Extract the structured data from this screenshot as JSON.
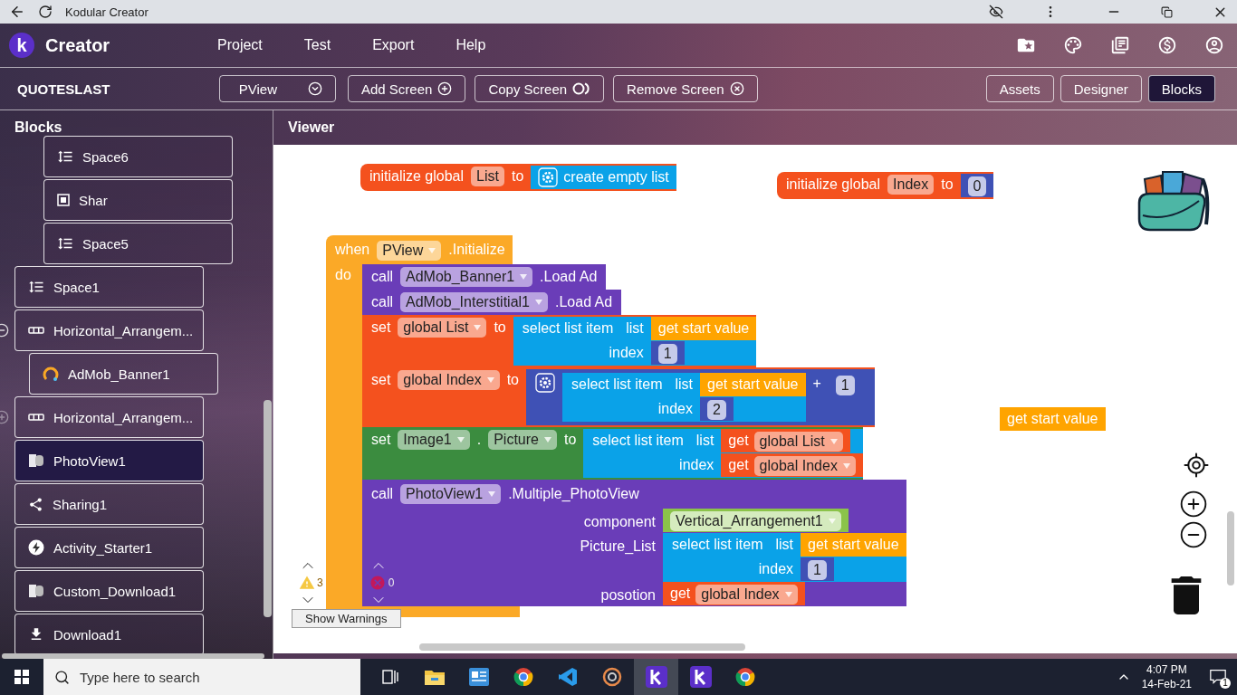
{
  "browser": {
    "title": "Kodular Creator"
  },
  "header": {
    "logo": "k",
    "brand": "Creator",
    "menu": [
      "Project",
      "Test",
      "Export",
      "Help"
    ]
  },
  "toolbar": {
    "project": "QUOTESLAST",
    "screen": "PView",
    "actions": [
      {
        "kind": "add",
        "label": "Add Screen"
      },
      {
        "kind": "copy",
        "label": "Copy Screen"
      },
      {
        "kind": "remove",
        "label": "Remove Screen"
      }
    ],
    "views": [
      {
        "label": "Assets",
        "selected": false
      },
      {
        "label": "Designer",
        "selected": false
      },
      {
        "label": "Blocks",
        "selected": true
      }
    ]
  },
  "sidebar": {
    "title": "Blocks",
    "items": [
      {
        "children": [
          {
            "children": [
              {
                "label": "Space6",
                "kind": "space",
                "selected": false
              },
              {
                "label": "Shar",
                "kind": "square",
                "selected": false
              },
              {
                "label": "Space5",
                "kind": "space",
                "selected": false
              }
            ]
          }
        ]
      },
      {
        "label": "Space1",
        "kind": "space",
        "selected": false
      },
      {
        "label": "Horizontal_Arrangem...",
        "kind": "arrangement",
        "selected": false,
        "expanded": true,
        "children": [
          {
            "label": "AdMob_Banner1",
            "kind": "admob",
            "selected": false
          }
        ]
      },
      {
        "label": "Horizontal_Arrangem...",
        "kind": "arrangement",
        "selected": false,
        "expanded": false
      },
      {
        "label": "PhotoView1",
        "kind": "photoview",
        "selected": true
      },
      {
        "label": "Sharing1",
        "kind": "share",
        "selected": false
      },
      {
        "label": "Activity_Starter1",
        "kind": "activity",
        "selected": false
      },
      {
        "label": "Custom_Download1",
        "kind": "photoview",
        "selected": false
      },
      {
        "label": "Download1",
        "kind": "download",
        "selected": false
      }
    ]
  },
  "viewer": {
    "title": "Viewer",
    "blocks": [
      {
        "kind": "init",
        "label": "initialize global",
        "name": "List",
        "to": "to",
        "value": {
          "kind": "empty_list",
          "text": "create empty list"
        }
      },
      {
        "kind": "init",
        "label": "initialize global",
        "name": "Index",
        "to": "to",
        "value": {
          "kind": "number",
          "value": "0"
        }
      },
      {
        "kind": "event",
        "when": "when",
        "component": "PView",
        "event": ".Initialize",
        "do": "do",
        "statements": [
          {
            "kind": "call",
            "keyword": "call",
            "component": "AdMob_Banner1",
            "method": ".Load Ad"
          },
          {
            "kind": "call",
            "keyword": "call",
            "component": "AdMob_Interstitial1",
            "method": ".Load Ad"
          },
          {
            "kind": "set_var",
            "keyword": "set",
            "name": "global List",
            "to": "to",
            "value": {
              "kind": "select",
              "label": "select list item",
              "list_label": "list",
              "index_label": "index",
              "list": {
                "kind": "get_start",
                "text": "get start value"
              },
              "index": {
                "kind": "number",
                "value": "1"
              }
            }
          },
          {
            "kind": "set_var",
            "keyword": "set",
            "name": "global Index",
            "to": "to",
            "value": {
              "kind": "add",
              "op": "+",
              "left": {
                "kind": "select",
                "label": "select list item",
                "list_label": "list",
                "index_label": "index",
                "list": {
                  "kind": "get_start",
                  "text": "get start value"
                },
                "index": {
                  "kind": "number",
                  "value": "2"
                }
              },
              "right": {
                "kind": "number",
                "value": "1"
              }
            }
          },
          {
            "kind": "set_prop",
            "keyword": "set",
            "component": "Image1",
            "dot": ".",
            "property": "Picture",
            "to": "to",
            "value": {
              "kind": "select",
              "label": "select list item",
              "list_label": "list",
              "index_label": "index",
              "list": {
                "kind": "get",
                "keyword": "get",
                "name": "global List"
              },
              "index": {
                "kind": "get",
                "keyword": "get",
                "name": "global Index"
              }
            }
          },
          {
            "kind": "call_args",
            "keyword": "call",
            "component": "PhotoView1",
            "method": ".Multiple_PhotoView",
            "args": [
              {
                "label": "component",
                "value": {
                  "kind": "component",
                  "name": "Vertical_Arrangement1"
                }
              },
              {
                "label": "Picture_List",
                "value": {
                  "kind": "select",
                  "label": "select list item",
                  "list_label": "list",
                  "index_label": "index",
                  "list": {
                    "kind": "get_start",
                    "text": "get start value"
                  },
                  "index": {
                    "kind": "number",
                    "value": "1"
                  }
                }
              },
              {
                "label": "posotion",
                "value": {
                  "kind": "get",
                  "keyword": "get",
                  "name": "global Index"
                }
              }
            ]
          }
        ]
      },
      {
        "kind": "expr",
        "value": {
          "kind": "get_start",
          "text": "get start value"
        }
      }
    ],
    "warnings": "3",
    "errors": "0",
    "show_warnings": "Show Warnings"
  },
  "taskbar": {
    "search_placeholder": "Type here to search",
    "time": "4:07 PM",
    "date": "14-Feb-21",
    "notifications": "1"
  }
}
